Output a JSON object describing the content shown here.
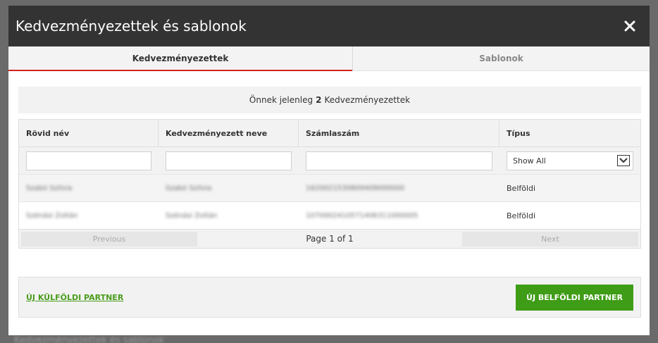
{
  "backdrop": {
    "text": "Kedvezményezettek és sablonok"
  },
  "modal": {
    "title": "Kedvezményezettek és sablonok",
    "close_icon": "close-icon"
  },
  "tabs": [
    {
      "label": "Kedvezményezettek",
      "active": true
    },
    {
      "label": "Sablonok",
      "active": false
    }
  ],
  "summary": {
    "prefix": "Önnek jelenleg",
    "count": "2",
    "suffix": "Kedvezményezettek"
  },
  "table": {
    "columns": [
      "Rövid név",
      "Kedvezményezett neve",
      "Számlaszám",
      "Típus"
    ],
    "filter": {
      "select_value": "Show All"
    },
    "rows": [
      {
        "short_name": "Szabó Szilvia",
        "full_name": "Szabó Szilvia",
        "account": "1620021530809409000000",
        "type": "Belföldi"
      },
      {
        "short_name": "Szénási Zoltán",
        "full_name": "Szénási Zoltán",
        "account": "1070002410571406311000005",
        "type": "Belföldi"
      }
    ]
  },
  "pager": {
    "previous": "Previous",
    "info": "Page 1 of 1",
    "next": "Next"
  },
  "footer": {
    "foreign_partner": "ÚJ KÜLFÖLDI PARTNER",
    "domestic_partner": "ÚJ BELFÖLDI PARTNER"
  },
  "colors": {
    "header_bg": "#333333",
    "active_tab_underline": "#d0251c",
    "primary_green": "#3f9c16",
    "link_green": "#4a9c1c"
  }
}
